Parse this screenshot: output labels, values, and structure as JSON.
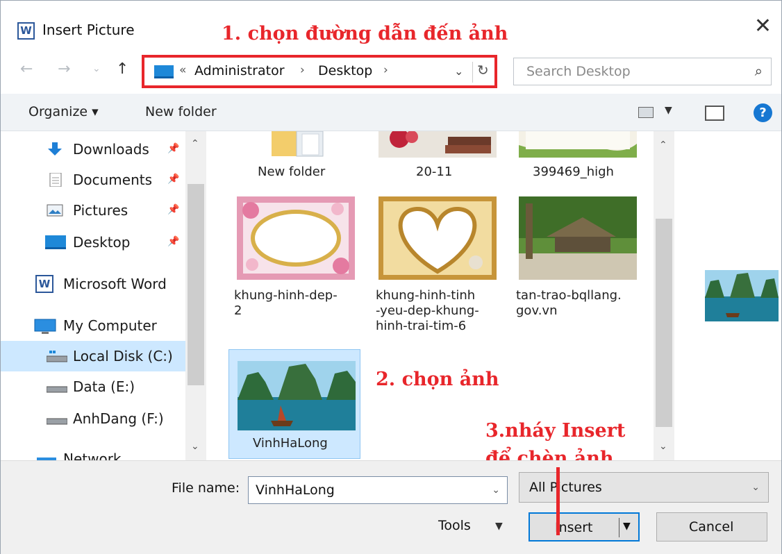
{
  "window": {
    "title": "Insert Picture",
    "app_icon": "word-icon",
    "close": "✕"
  },
  "annotations": {
    "step1": "1. chọn đường dẫn đến ảnh",
    "step2": "2. chọn ảnh",
    "step3_line1": "3.nháy Insert",
    "step3_line2": "để chèn ảnh",
    "color": "#e8262b"
  },
  "nav": {
    "back": "←",
    "forward": "→",
    "recent": "⌄",
    "up": "↑",
    "address": {
      "overflow": "«",
      "items": [
        "Administrator",
        "Desktop"
      ],
      "sep": "›"
    },
    "refresh": "↻",
    "search_placeholder": "Search Desktop"
  },
  "toolbar": {
    "organize": "Organize ▾",
    "new_folder": "New folder",
    "help": "?"
  },
  "sidebar": {
    "items": [
      {
        "label": "Downloads",
        "icon": "download-arrow-icon",
        "pinned": true
      },
      {
        "label": "Documents",
        "icon": "document-icon",
        "pinned": true
      },
      {
        "label": "Pictures",
        "icon": "pictures-icon",
        "pinned": true
      },
      {
        "label": "Desktop",
        "icon": "desktop-icon",
        "pinned": true
      },
      {
        "label": "Microsoft Word",
        "icon": "word-icon",
        "pinned": false
      },
      {
        "label": "My Computer",
        "icon": "computer-icon",
        "pinned": false
      },
      {
        "label": "Local Disk (C:)",
        "icon": "disk-icon",
        "pinned": false,
        "selected": true
      },
      {
        "label": "Data (E:)",
        "icon": "drive-icon",
        "pinned": false
      },
      {
        "label": "AnhDang (F:)",
        "icon": "drive-icon",
        "pinned": false
      },
      {
        "label": "Network",
        "icon": "network-icon",
        "pinned": false
      }
    ]
  },
  "files": [
    {
      "name": "New folder",
      "kind": "folder"
    },
    {
      "name": "20-11",
      "kind": "image"
    },
    {
      "name": "399469_high",
      "kind": "image"
    },
    {
      "name": "khung-hinh-dep-\n2",
      "kind": "image"
    },
    {
      "name": "khung-hinh-tinh\n-yeu-dep-khung-\nhinh-trai-tim-6",
      "kind": "image"
    },
    {
      "name": "tan-trao-bqllang.\ngov.vn",
      "kind": "image"
    },
    {
      "name": "VinhHaLong",
      "kind": "image",
      "selected": true
    }
  ],
  "bottom": {
    "file_name_label": "File name:",
    "file_name_value": "VinhHaLong",
    "file_type": "All Pictures",
    "tools": "Tools",
    "insert": "Insert",
    "cancel": "Cancel"
  }
}
